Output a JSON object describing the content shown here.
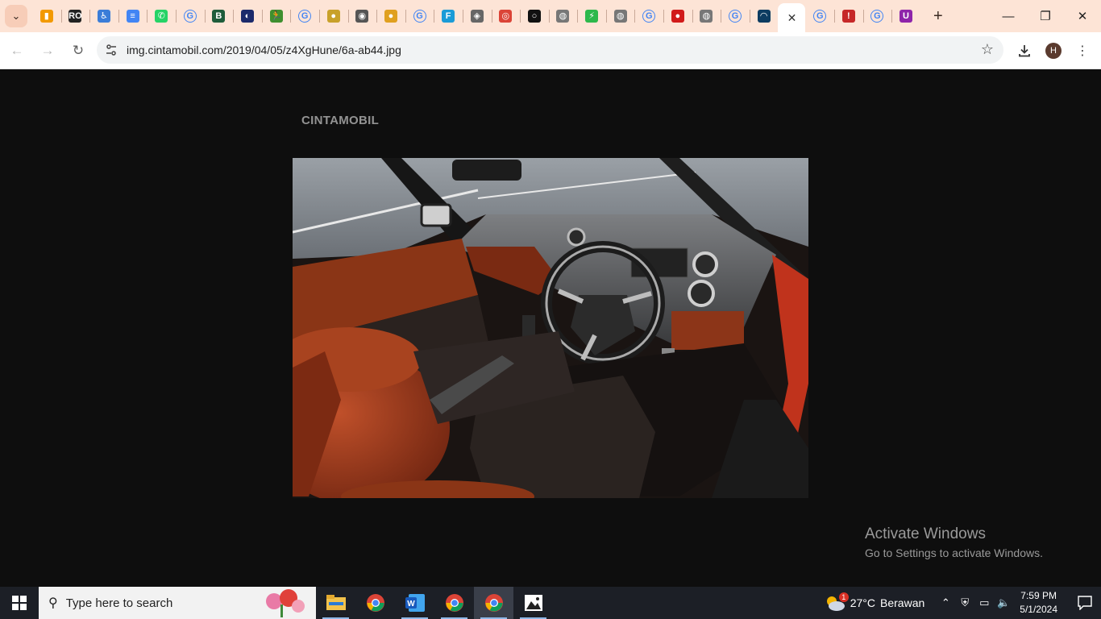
{
  "browser": {
    "tabs": [
      {
        "icon": "analytics-icon",
        "color": "#f29900",
        "glyph": "▮"
      },
      {
        "icon": "ro-icon",
        "color": "#222222",
        "glyph": "RO"
      },
      {
        "icon": "accessibility-icon",
        "color": "#3b7dd8",
        "glyph": "♿"
      },
      {
        "icon": "docs-icon",
        "color": "#4285f4",
        "glyph": "≡"
      },
      {
        "icon": "whatsapp-icon",
        "color": "#25d366",
        "glyph": "✆"
      },
      {
        "icon": "google-icon",
        "color": "#ffffff",
        "glyph": "G"
      },
      {
        "icon": "b-icon",
        "color": "#1e5c3a",
        "glyph": "B"
      },
      {
        "icon": "moon-icon",
        "color": "#1b2a6b",
        "glyph": "◐"
      },
      {
        "icon": "runner-icon",
        "color": "#3f8f2f",
        "glyph": "🏃"
      },
      {
        "icon": "google-icon",
        "color": "#ffffff",
        "glyph": "G"
      },
      {
        "icon": "medal-icon",
        "color": "#c8a12a",
        "glyph": "●"
      },
      {
        "icon": "wolf-icon",
        "color": "#555555",
        "glyph": "◉"
      },
      {
        "icon": "bear-icon",
        "color": "#e0a020",
        "glyph": "●"
      },
      {
        "icon": "google-icon",
        "color": "#ffffff",
        "glyph": "G"
      },
      {
        "icon": "f-icon",
        "color": "#1a9bd7",
        "glyph": "F"
      },
      {
        "icon": "shield-icon",
        "color": "#666666",
        "glyph": "◈"
      },
      {
        "icon": "chrome-icon",
        "color": "#db4437",
        "glyph": "◎"
      },
      {
        "icon": "circle-icon",
        "color": "#111111",
        "glyph": "○"
      },
      {
        "icon": "globe-icon",
        "color": "#777777",
        "glyph": "◍"
      },
      {
        "icon": "bolt-icon",
        "color": "#2db84b",
        "glyph": "⚡"
      },
      {
        "icon": "globe-icon",
        "color": "#777777",
        "glyph": "◍"
      },
      {
        "icon": "google-icon",
        "color": "#ffffff",
        "glyph": "G"
      },
      {
        "icon": "red-dot-icon",
        "color": "#d11a1a",
        "glyph": "●"
      },
      {
        "icon": "globe-icon",
        "color": "#777777",
        "glyph": "◍"
      },
      {
        "icon": "google-icon",
        "color": "#ffffff",
        "glyph": "G"
      },
      {
        "icon": "wave-icon",
        "color": "#0d3c61",
        "glyph": "◠"
      }
    ],
    "active_tab": {
      "close_glyph": "✕"
    },
    "tabs_after": [
      {
        "icon": "google-icon",
        "color": "#ffffff",
        "glyph": "G"
      },
      {
        "icon": "pin-icon",
        "color": "#c62828",
        "glyph": "!"
      },
      {
        "icon": "google-icon",
        "color": "#ffffff",
        "glyph": "G"
      },
      {
        "icon": "magnet-icon",
        "color": "#8e24aa",
        "glyph": "U"
      }
    ],
    "url": "img.cintamobil.com/2019/04/05/z4XgHune/6a-ab44.jpg",
    "profile_initial": "H",
    "tab_strip_color": "#fde4d6"
  },
  "page": {
    "watermark": "CINTAMOBIL",
    "activate_title": "Activate Windows",
    "activate_sub": "Go to Settings to activate Windows."
  },
  "taskbar": {
    "search_placeholder": "Type here to search",
    "weather_temp": "27°C",
    "weather_desc": "Berawan",
    "weather_badge": "1",
    "time": "7:59 PM",
    "date": "5/1/2024"
  }
}
